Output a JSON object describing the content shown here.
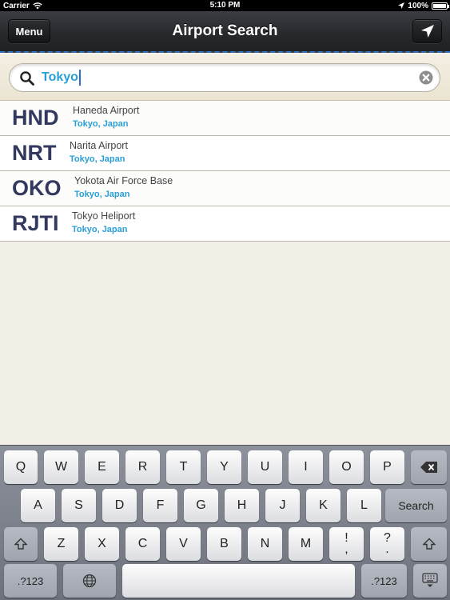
{
  "status_bar": {
    "carrier": "Carrier",
    "time": "5:10 PM",
    "battery": "100%"
  },
  "nav": {
    "title": "Airport Search",
    "menu_label": "Menu",
    "locate_icon": "location-arrow-icon"
  },
  "search": {
    "query": "Tokyo"
  },
  "results": [
    {
      "code": "HND",
      "name": "Haneda Airport",
      "location": "Tokyo, Japan"
    },
    {
      "code": "NRT",
      "name": "Narita Airport",
      "location": "Tokyo, Japan"
    },
    {
      "code": "OKO",
      "name": "Yokota Air Force Base",
      "location": "Tokyo, Japan"
    },
    {
      "code": "RJTI",
      "name": "Tokyo Heliport",
      "location": "Tokyo, Japan"
    }
  ],
  "keyboard": {
    "row1": [
      "Q",
      "W",
      "E",
      "R",
      "T",
      "Y",
      "U",
      "I",
      "O",
      "P"
    ],
    "row2": [
      "A",
      "S",
      "D",
      "F",
      "G",
      "H",
      "J",
      "K",
      "L"
    ],
    "row3": [
      "Z",
      "X",
      "C",
      "V",
      "B",
      "N",
      "M"
    ],
    "search_label": "Search",
    "numbers_label": ".?123",
    "punct1_top": "!",
    "punct1_bottom": ",",
    "punct2_top": "?",
    "punct2_bottom": "."
  },
  "colors": {
    "accent": "#2a9fd6",
    "code": "#33385e"
  }
}
